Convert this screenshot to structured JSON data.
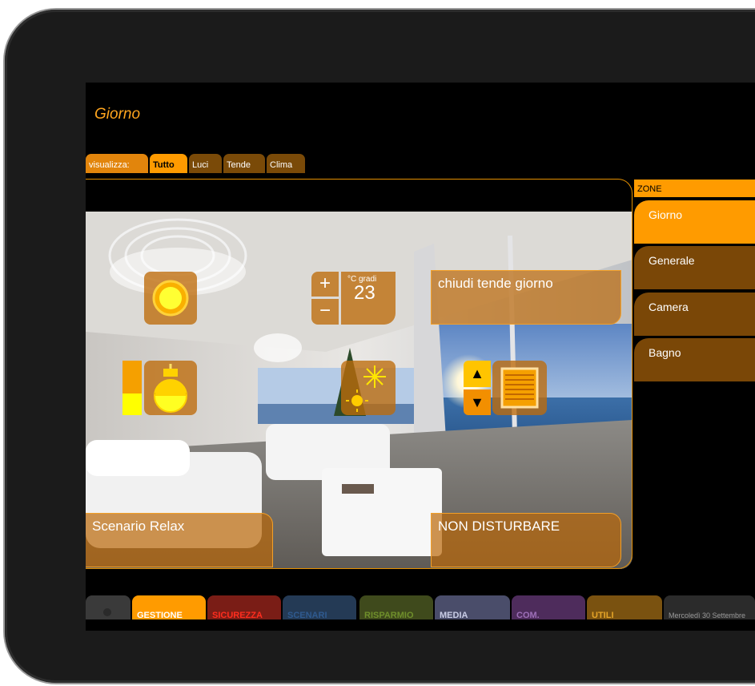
{
  "page_title": "Giorno",
  "filter_tabs": [
    {
      "label": "visualizza:"
    },
    {
      "label": "Tutto",
      "active": true
    },
    {
      "label": "Luci"
    },
    {
      "label": "Tende"
    },
    {
      "label": "Clima"
    }
  ],
  "controls": {
    "light_icon": "light-bulb-icon",
    "plus_label": "+",
    "minus_label": "−",
    "temp_unit": "°C gradi",
    "temp_value": "23",
    "blinds_scene_label": "chiudi tende giorno",
    "dimmer_level": 0.4,
    "climate_icon": "snowflake-sun-icon",
    "up_icon": "▲",
    "down_icon": "▼",
    "scenario_label": "Scenario Relax",
    "dnd_label": "NON DISTURBARE"
  },
  "zones": {
    "header": "ZONE",
    "items": [
      {
        "label": "Giorno",
        "active": true
      },
      {
        "label": "Generale"
      },
      {
        "label": "Camera"
      },
      {
        "label": "Bagno"
      }
    ]
  },
  "nav_tabs": [
    {
      "label": "",
      "color": "#3a3a3a"
    },
    {
      "label": "GESTIONE",
      "color": "#ff9b00",
      "text_color": "#ffffff"
    },
    {
      "label": "SICUREZZA",
      "color": "#7a1d16",
      "text_color": "#ff2d1e"
    },
    {
      "label": "SCENARI",
      "color": "#243a55",
      "text_color": "#2f5a8f"
    },
    {
      "label": "RISPARMIO",
      "color": "#3f4a1c",
      "text_color": "#6f8f2b"
    },
    {
      "label": "MEDIA",
      "color": "#4a4d6a",
      "text_color": "#c9cde6"
    },
    {
      "label": "COM.",
      "color": "#4e2c5c",
      "text_color": "#9d6fb8"
    },
    {
      "label": "UTILI",
      "color": "#7a5210",
      "text_color": "#e5a428"
    },
    {
      "label": "Mercoledì 30 Settembre",
      "color": "#2b2b2b",
      "text_color": "#9a9a9a"
    }
  ]
}
